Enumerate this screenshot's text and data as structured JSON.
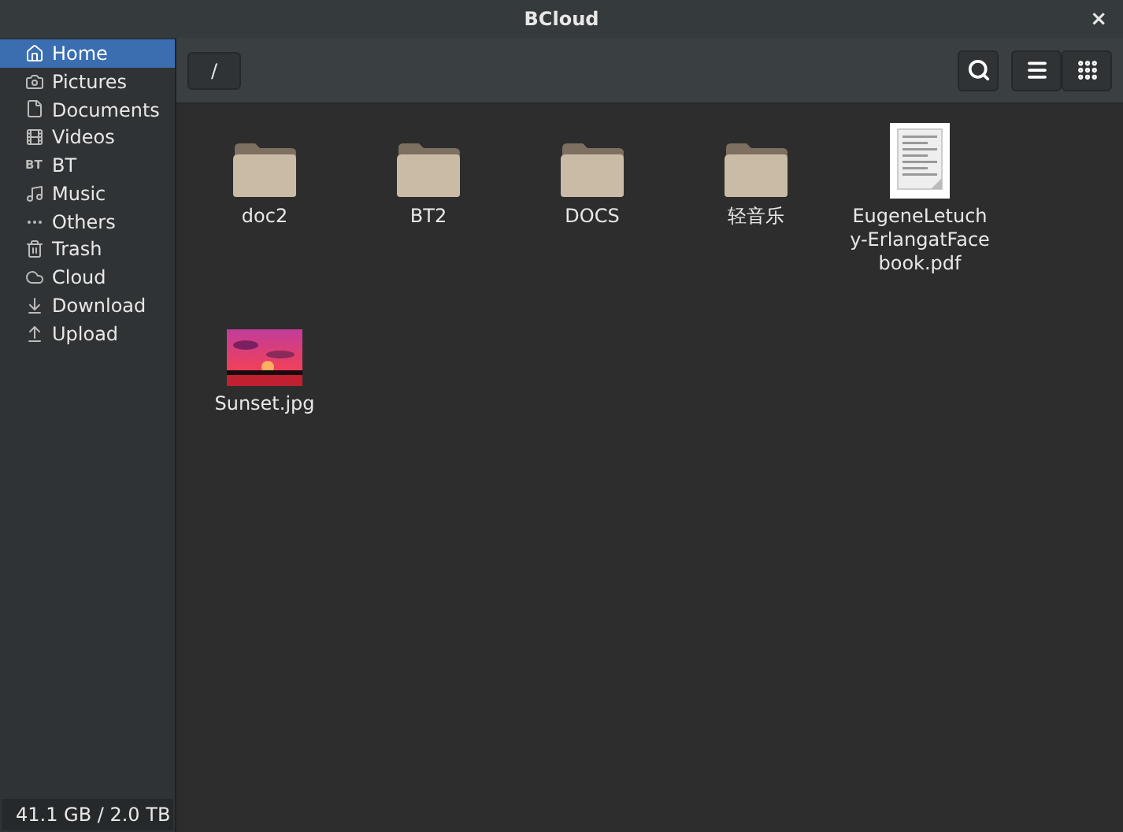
{
  "window": {
    "title": "BCloud",
    "close": "×"
  },
  "sidebar": {
    "items": [
      {
        "label": "Home",
        "selected": true
      },
      {
        "label": "Pictures",
        "selected": false
      },
      {
        "label": "Documents",
        "selected": false
      },
      {
        "label": "Videos",
        "selected": false
      },
      {
        "label": "BT",
        "selected": false,
        "glyph": "BT"
      },
      {
        "label": "Music",
        "selected": false
      },
      {
        "label": "Others",
        "selected": false
      },
      {
        "label": "Trash",
        "selected": false
      },
      {
        "label": "Cloud",
        "selected": false
      },
      {
        "label": "Download",
        "selected": false
      },
      {
        "label": "Upload",
        "selected": false
      }
    ]
  },
  "path": "/",
  "view_buttons": [
    {
      "kind": "search"
    },
    {
      "kind": "list"
    },
    {
      "kind": "grid"
    }
  ],
  "files": [
    {
      "name": "doc2",
      "kind": "folder"
    },
    {
      "name": "BT2",
      "kind": "folder"
    },
    {
      "name": "DOCS",
      "kind": "folder"
    },
    {
      "name": "轻音乐",
      "kind": "folder"
    },
    {
      "name": "EugeneLetuchy-ErlangatFacebook.pdf",
      "kind": "pdf"
    },
    {
      "name": "Sunset.jpg"
    }
  ],
  "status_bar": "41.1 GB / 2.0 TB"
}
